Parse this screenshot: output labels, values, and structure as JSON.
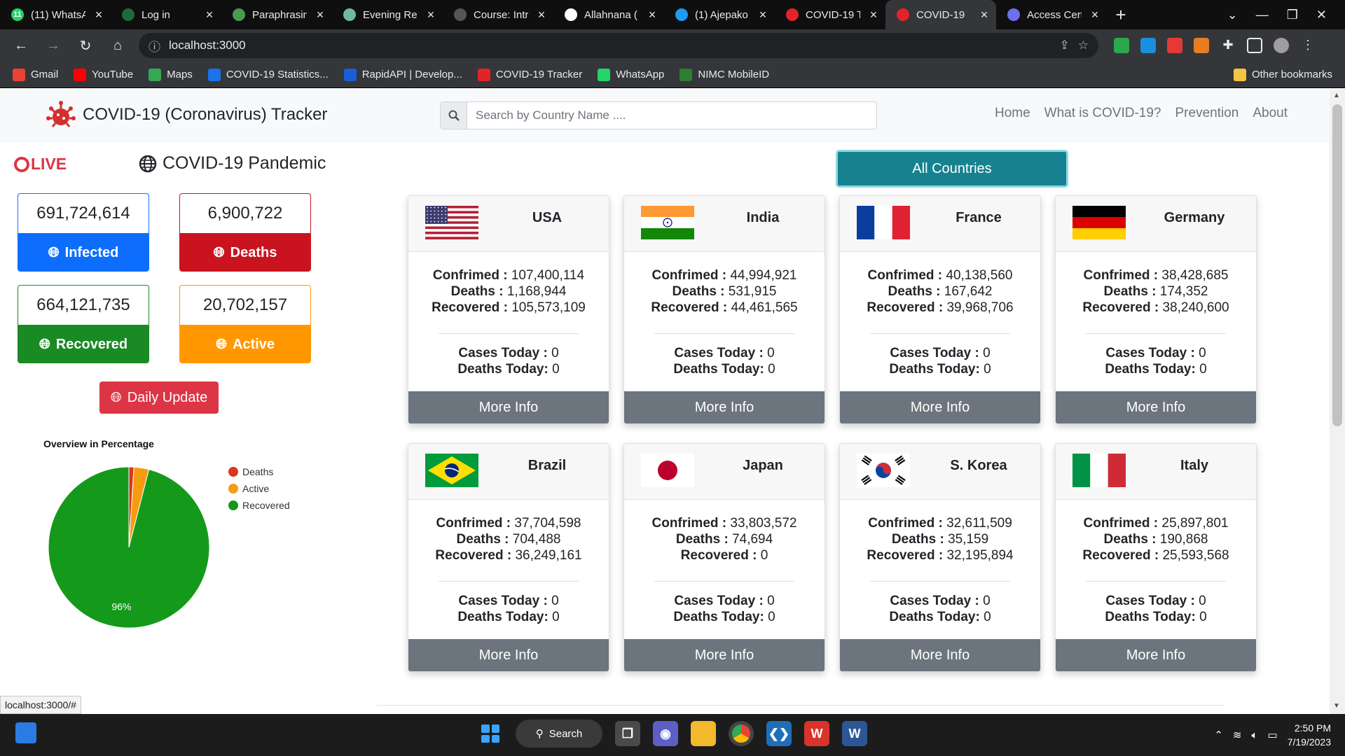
{
  "browser": {
    "tabs": [
      {
        "title": "(11) WhatsA",
        "favicon_color": "#25d366",
        "favicon_text": "11"
      },
      {
        "title": "Log in",
        "favicon_color": "#1e6b3a",
        "favicon_text": ""
      },
      {
        "title": "Paraphrasin",
        "favicon_color": "#4a9b52",
        "favicon_text": ""
      },
      {
        "title": "Evening Rec",
        "favicon_color": "#6fb8a7",
        "favicon_text": ""
      },
      {
        "title": "Course: Intr",
        "favicon_color": "#555555",
        "favicon_text": ""
      },
      {
        "title": "Allahnana (",
        "favicon_color": "#ffffff",
        "favicon_text": ""
      },
      {
        "title": "(1) Ajepako",
        "favicon_color": "#1d9bf0",
        "favicon_text": ""
      },
      {
        "title": "COVID-19 T",
        "favicon_color": "#e0242a",
        "favicon_text": ""
      },
      {
        "title": "COVID-19",
        "favicon_color": "#e0242a",
        "favicon_text": ""
      },
      {
        "title": "Access Cert",
        "favicon_color": "#6e6ef0",
        "favicon_text": ""
      }
    ],
    "url": "localhost:3000",
    "bookmarks": [
      {
        "label": "Gmail",
        "color": "#ea4335"
      },
      {
        "label": "YouTube",
        "color": "#ff0000"
      },
      {
        "label": "Maps",
        "color": "#34a853"
      },
      {
        "label": "COVID-19 Statistics...",
        "color": "#1a73e8"
      },
      {
        "label": "RapidAPI | Develop...",
        "color": "#1a5fd6"
      },
      {
        "label": "COVID-19 Tracker",
        "color": "#e0242a"
      },
      {
        "label": "WhatsApp",
        "color": "#25d366"
      },
      {
        "label": "NIMC MobileID",
        "color": "#2e7d32"
      }
    ],
    "other_bookmarks": "Other bookmarks",
    "status_url": "localhost:3000/#"
  },
  "app": {
    "brand": "COVID-19 (Coronavirus) Tracker",
    "search_placeholder": "Search by Country Name ....",
    "nav": [
      "Home",
      "What is COVID-19?",
      "Prevention",
      "About"
    ],
    "live": "LIVE",
    "pandemic_title": "COVID-19 Pandemic",
    "stats": {
      "infected": {
        "value": "691,724,614",
        "label": "Infected",
        "color": "#0d6efd"
      },
      "deaths": {
        "value": "6,900,722",
        "label": "Deaths",
        "color": "#c9141f"
      },
      "recovered": {
        "value": "664,121,735",
        "label": "Recovered",
        "color": "#198a24"
      },
      "active": {
        "value": "20,702,157",
        "label": "Active",
        "color": "#ff9800"
      }
    },
    "daily_update": "Daily Update",
    "chart_title": "Overview in Percentage",
    "all_countries": "All Countries",
    "more_info": "More Info",
    "labels": {
      "confirmed": "Confrimed",
      "deaths": "Deaths",
      "recovered": "Recovered",
      "cases_today": "Cases Today",
      "deaths_today": "Deaths Today"
    }
  },
  "chart_data": {
    "type": "pie",
    "title": "Overview in Percentage",
    "categories": [
      "Deaths",
      "Active",
      "Recovered"
    ],
    "values": [
      6900722,
      20702157,
      664121735
    ],
    "percent_labels": [
      "",
      "",
      "96%"
    ],
    "colors": [
      "#d9361c",
      "#f59c10",
      "#15991b"
    ],
    "legend_position": "right"
  },
  "countries": [
    {
      "name": "USA",
      "flag": "usa-flag",
      "confirmed": "107,400,114",
      "deaths": "1,168,944",
      "recovered": "105,573,109",
      "cases_today": "0",
      "deaths_today": "0"
    },
    {
      "name": "India",
      "flag": "india-flag",
      "confirmed": "44,994,921",
      "deaths": "531,915",
      "recovered": "44,461,565",
      "cases_today": "0",
      "deaths_today": "0"
    },
    {
      "name": "France",
      "flag": "france-flag",
      "confirmed": "40,138,560",
      "deaths": "167,642",
      "recovered": "39,968,706",
      "cases_today": "0",
      "deaths_today": "0"
    },
    {
      "name": "Germany",
      "flag": "germany-flag",
      "confirmed": "38,428,685",
      "deaths": "174,352",
      "recovered": "38,240,600",
      "cases_today": "0",
      "deaths_today": "0"
    },
    {
      "name": "Brazil",
      "flag": "brazil-flag",
      "confirmed": "37,704,598",
      "deaths": "704,488",
      "recovered": "36,249,161",
      "cases_today": "0",
      "deaths_today": "0"
    },
    {
      "name": "Japan",
      "flag": "japan-flag",
      "confirmed": "33,803,572",
      "deaths": "74,694",
      "recovered": "0",
      "cases_today": "0",
      "deaths_today": "0"
    },
    {
      "name": "S. Korea",
      "flag": "korea-flag",
      "confirmed": "32,611,509",
      "deaths": "35,159",
      "recovered": "32,195,894",
      "cases_today": "0",
      "deaths_today": "0"
    },
    {
      "name": "Italy",
      "flag": "italy-flag",
      "confirmed": "25,897,801",
      "deaths": "190,868",
      "recovered": "25,593,568",
      "cases_today": "0",
      "deaths_today": "0"
    }
  ],
  "taskbar": {
    "search_label": "Search",
    "time": "2:50 PM",
    "date": "7/19/2023"
  }
}
